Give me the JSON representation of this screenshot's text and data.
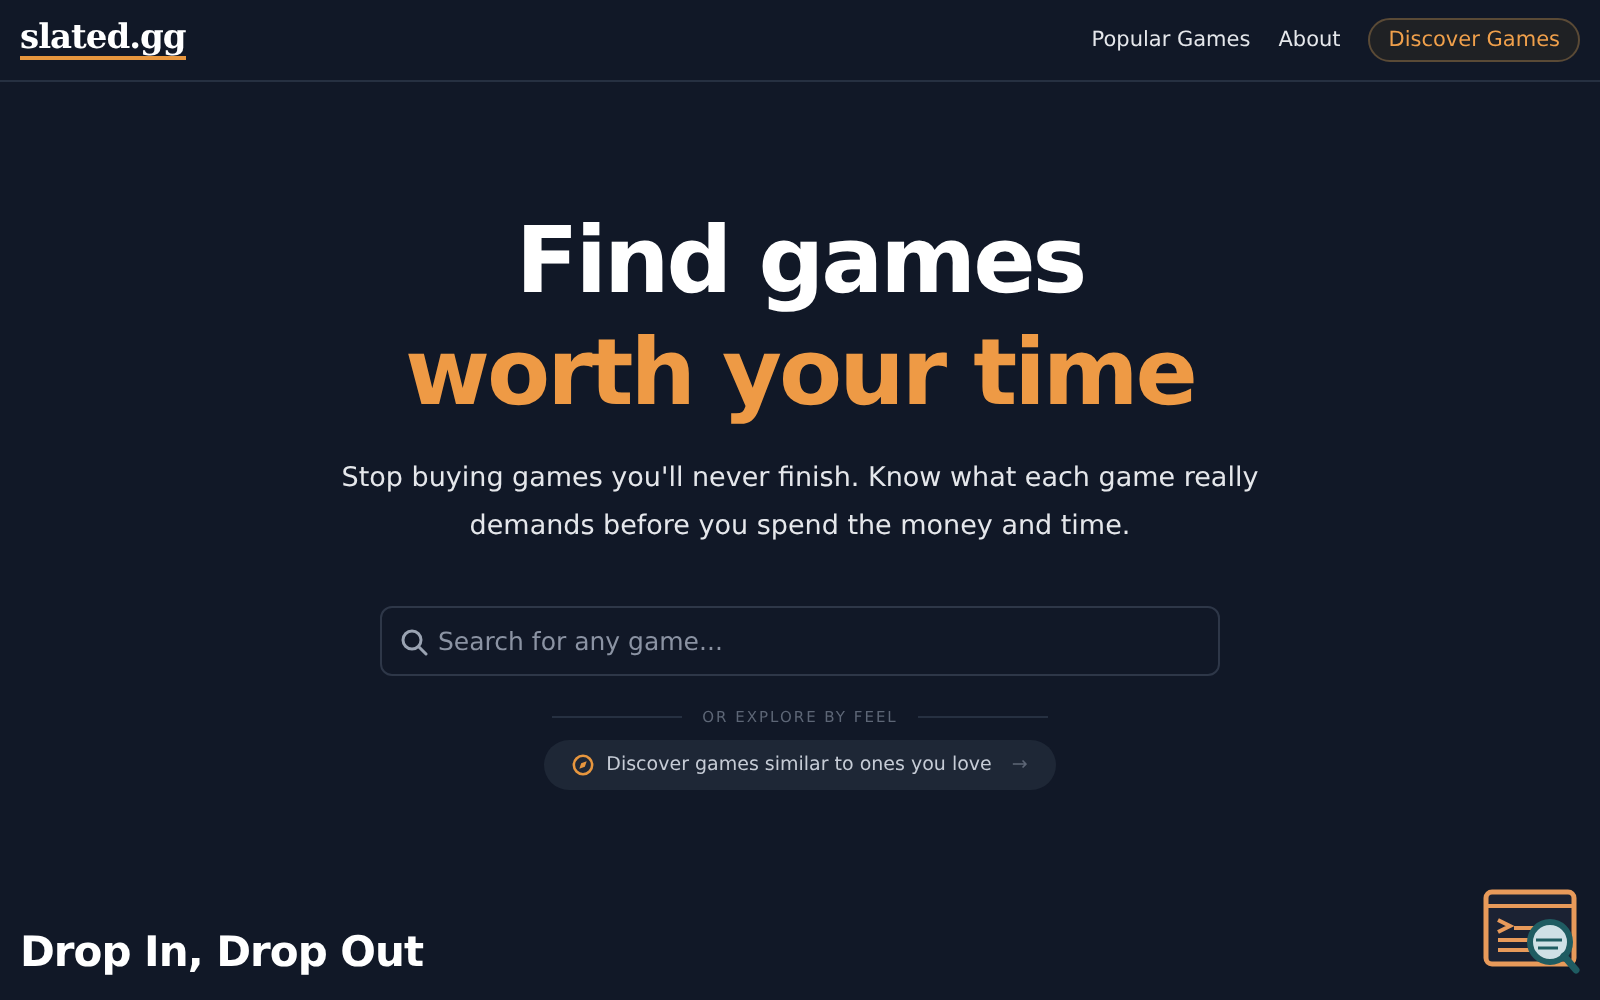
{
  "logo": "slated.gg",
  "nav": [
    {
      "label": "Popular Games"
    },
    {
      "label": "About"
    }
  ],
  "nav_button": "Discover Games",
  "hero": {
    "title_line_1": "Find games",
    "title_line_2": "worth your time",
    "subtitle": "Stop buying games you'll never finish. Know what each game really demands before you spend the money and time."
  },
  "search": {
    "placeholder": "Search for any game..."
  },
  "divider_label": "OR EXPLORE BY FEEL",
  "discover_link": {
    "label": "Discover games similar to ones you love",
    "arrow": "→"
  },
  "section_title": "Drop In, Drop Out"
}
